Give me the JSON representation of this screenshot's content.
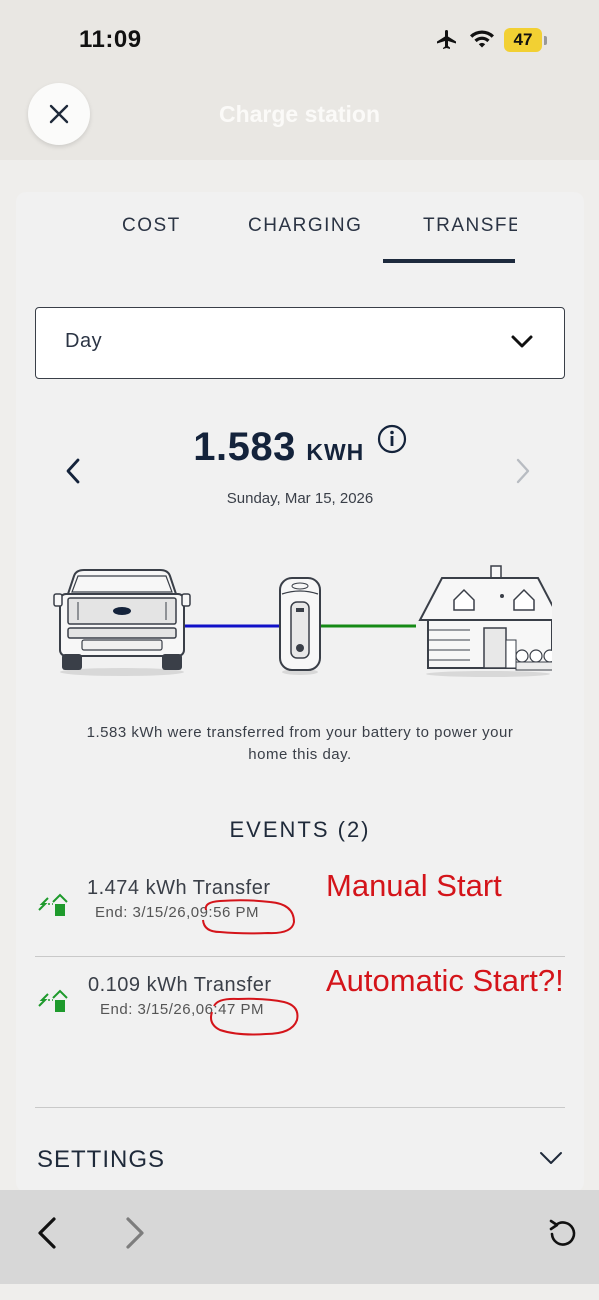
{
  "status_bar": {
    "time": "11:09",
    "battery": "47",
    "icons": [
      "airplane-icon",
      "wifi-icon",
      "battery-icon"
    ]
  },
  "header": {
    "title": "Charge station",
    "close_icon": "close-icon"
  },
  "tabs": [
    {
      "label": "COST",
      "active": false
    },
    {
      "label": "CHARGING",
      "active": false
    },
    {
      "label": "TRANSFEF",
      "active": true
    }
  ],
  "period_select": {
    "value": "Day"
  },
  "summary": {
    "amount": "1.583",
    "unit": "KWH",
    "date": "Sunday, Mar 15, 2026",
    "description": "1.583 kWh were transferred from your battery to power your home this day."
  },
  "events": {
    "title": "EVENTS (2)",
    "items": [
      {
        "title": "1.474 kWh Transfer",
        "end_prefix": "End: 3/15/26,",
        "end_time": "09:56 PM",
        "annotation": "Manual Start"
      },
      {
        "title": "0.109 kWh Transfer",
        "end_prefix": "End: 3/15/26,",
        "end_time": "06:47 PM",
        "annotation": "Automatic Start?!"
      }
    ]
  },
  "settings": {
    "label": "SETTINGS"
  },
  "colors": {
    "accent": "#14233b",
    "annotation_red": "#d4141a",
    "flow_blue": "#1010c8",
    "flow_green": "#168a16",
    "event_icon_green": "#1e9a2c"
  },
  "browser_bar": {
    "icons": [
      "back-arrow-icon",
      "forward-arrow-icon",
      "reload-icon"
    ]
  }
}
